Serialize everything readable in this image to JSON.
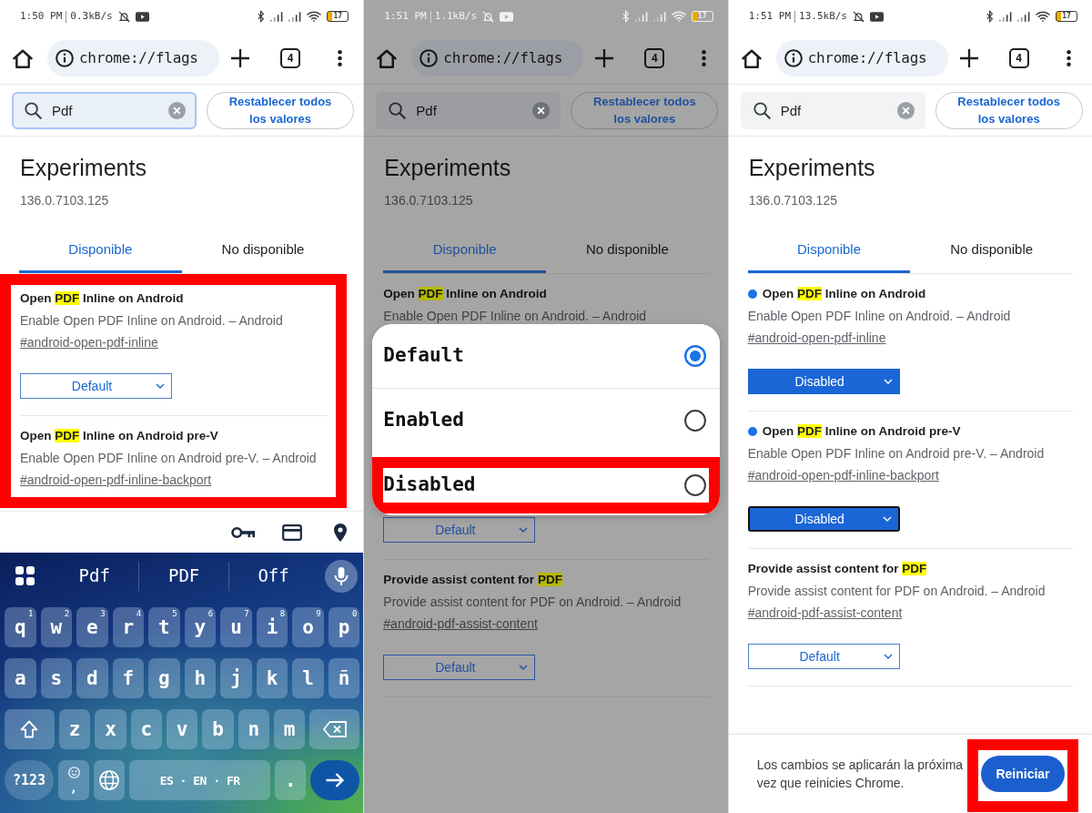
{
  "panels": [
    {
      "status_bar": {
        "time": "1:50 PM",
        "speed": "0.3kB/s",
        "battery": "17"
      },
      "address_bar": {
        "url": "chrome://flags",
        "tab_count": "4"
      },
      "search": {
        "value": "Pdf",
        "focused": true
      },
      "reset_button": "Restablecer todos los valores",
      "heading": "Experiments",
      "version": "136.0.7103.125",
      "tabs": [
        {
          "label": "Disponible",
          "selected": true
        },
        {
          "label": "No disponible",
          "selected": false
        }
      ],
      "flags_highlighted": true,
      "flags": [
        {
          "title_parts": [
            {
              "text": "Open ",
              "match": false
            },
            {
              "text": "PDF",
              "match": true
            },
            {
              "text": " Inline on Android",
              "match": false
            }
          ],
          "modified": false,
          "description": "Enable Open PDF Inline on Android. – Android",
          "link": "#android-open-pdf-inline",
          "select": {
            "value": "Default",
            "focused": false
          }
        },
        {
          "title_parts": [
            {
              "text": "Open ",
              "match": false
            },
            {
              "text": "PDF",
              "match": true
            },
            {
              "text": " Inline on Android pre-V",
              "match": false
            }
          ],
          "modified": false,
          "description": "Enable Open PDF Inline on Android pre-V. – Android",
          "link": "#android-open-pdf-inline-backport"
        }
      ],
      "keyboard": {
        "suggestions": [
          "Pdf",
          "PDF",
          "Off"
        ],
        "key_rows": [
          {
            "keys": [
              {
                "kind": "char",
                "label": "q",
                "hint": "1"
              },
              {
                "kind": "char",
                "label": "w",
                "hint": "2"
              },
              {
                "kind": "char",
                "label": "e",
                "hint": "3"
              },
              {
                "kind": "char",
                "label": "r",
                "hint": "4"
              },
              {
                "kind": "char",
                "label": "t",
                "hint": "5"
              },
              {
                "kind": "char",
                "label": "y",
                "hint": "6"
              },
              {
                "kind": "char",
                "label": "u",
                "hint": "7"
              },
              {
                "kind": "char",
                "label": "i",
                "hint": "8"
              },
              {
                "kind": "char",
                "label": "o",
                "hint": "9"
              },
              {
                "kind": "char",
                "label": "p",
                "hint": "0"
              }
            ]
          },
          {
            "keys": [
              {
                "kind": "char",
                "label": "a"
              },
              {
                "kind": "char",
                "label": "s"
              },
              {
                "kind": "char",
                "label": "d"
              },
              {
                "kind": "char",
                "label": "f"
              },
              {
                "kind": "char",
                "label": "g"
              },
              {
                "kind": "char",
                "label": "h"
              },
              {
                "kind": "char",
                "label": "j"
              },
              {
                "kind": "char",
                "label": "k"
              },
              {
                "kind": "char",
                "label": "l"
              },
              {
                "kind": "char",
                "label": "ñ"
              }
            ]
          },
          {
            "keys": [
              {
                "kind": "shift"
              },
              {
                "kind": "char",
                "label": "z"
              },
              {
                "kind": "char",
                "label": "x"
              },
              {
                "kind": "char",
                "label": "c"
              },
              {
                "kind": "char",
                "label": "v"
              },
              {
                "kind": "char",
                "label": "b"
              },
              {
                "kind": "char",
                "label": "n"
              },
              {
                "kind": "char",
                "label": "m"
              },
              {
                "kind": "backspace"
              }
            ]
          },
          {
            "keys": [
              {
                "kind": "symbols",
                "label": "?123"
              },
              {
                "kind": "emoji",
                "label": ","
              },
              {
                "kind": "globe"
              },
              {
                "kind": "space",
                "label": "ES · EN · FR"
              },
              {
                "kind": "char",
                "label": "."
              },
              {
                "kind": "enter"
              }
            ]
          }
        ]
      }
    },
    {
      "status_bar": {
        "time": "1:51 PM",
        "speed": "1.1kB/s",
        "battery": "17"
      },
      "address_bar": {
        "url": "chrome://flags",
        "tab_count": "4"
      },
      "search": {
        "value": "Pdf",
        "focused": false
      },
      "reset_button": "Restablecer todos los valores",
      "heading": "Experiments",
      "version": "136.0.7103.125",
      "tabs": [
        {
          "label": "Disponible",
          "selected": true
        },
        {
          "label": "No disponible",
          "selected": false
        }
      ],
      "flags_highlighted": false,
      "flags": [
        {
          "title_parts": [
            {
              "text": "Open ",
              "match": false
            },
            {
              "text": "PDF",
              "match": true
            },
            {
              "text": " Inline on Android",
              "match": false
            }
          ],
          "modified": false,
          "description": "Enable Open PDF Inline on Android. – Android",
          "select": {
            "options": [
              {
                "label": "Default",
                "selected": true,
                "highlighted": false
              },
              {
                "label": "Enabled",
                "selected": false,
                "highlighted": false
              },
              {
                "label": "Disabled",
                "selected": false,
                "highlighted": true
              }
            ]
          }
        },
        {
          "modified": false,
          "select": {
            "value": "Default",
            "focused": false
          }
        },
        {
          "title_parts": [
            {
              "text": "Provide assist content for ",
              "match": false
            },
            {
              "text": "PDF",
              "match": true
            }
          ],
          "modified": false,
          "description": "Provide assist content for PDF on Android. – Android",
          "link": "#android-pdf-assist-content",
          "select": {
            "value": "Default",
            "focused": false
          }
        }
      ]
    },
    {
      "status_bar": {
        "time": "1:51 PM",
        "speed": "13.5kB/s",
        "battery": "17"
      },
      "address_bar": {
        "url": "chrome://flags",
        "tab_count": "4"
      },
      "search": {
        "value": "Pdf",
        "focused": false
      },
      "reset_button": "Restablecer todos los valores",
      "heading": "Experiments",
      "version": "136.0.7103.125",
      "tabs": [
        {
          "label": "Disponible",
          "selected": true
        },
        {
          "label": "No disponible",
          "selected": false
        }
      ],
      "flags_highlighted": false,
      "flags": [
        {
          "title_parts": [
            {
              "text": "Open ",
              "match": false
            },
            {
              "text": "PDF",
              "match": true
            },
            {
              "text": " Inline on Android",
              "match": false
            }
          ],
          "modified": true,
          "description": "Enable Open PDF Inline on Android. – Android",
          "link": "#android-open-pdf-inline",
          "select": {
            "value": "Disabled",
            "focused": false
          }
        },
        {
          "title_parts": [
            {
              "text": "Open ",
              "match": false
            },
            {
              "text": "PDF",
              "match": true
            },
            {
              "text": " Inline on Android pre-V",
              "match": false
            }
          ],
          "modified": true,
          "description": "Enable Open PDF Inline on Android pre-V. – Android",
          "link": "#android-open-pdf-inline-backport",
          "select": {
            "value": "Disabled",
            "focused": true
          }
        },
        {
          "title_parts": [
            {
              "text": "Provide assist content for ",
              "match": false
            },
            {
              "text": "PDF",
              "match": true
            }
          ],
          "modified": false,
          "description": "Provide assist content for PDF on Android. – Android",
          "link": "#android-pdf-assist-content",
          "select": {
            "value": "Default",
            "focused": false
          }
        }
      ],
      "footer": {
        "message": "Los cambios se aplicarán la próxima vez que reinicies Chrome.",
        "restart_button": {
          "label": "Reiniciar",
          "highlighted": true
        }
      }
    }
  ]
}
